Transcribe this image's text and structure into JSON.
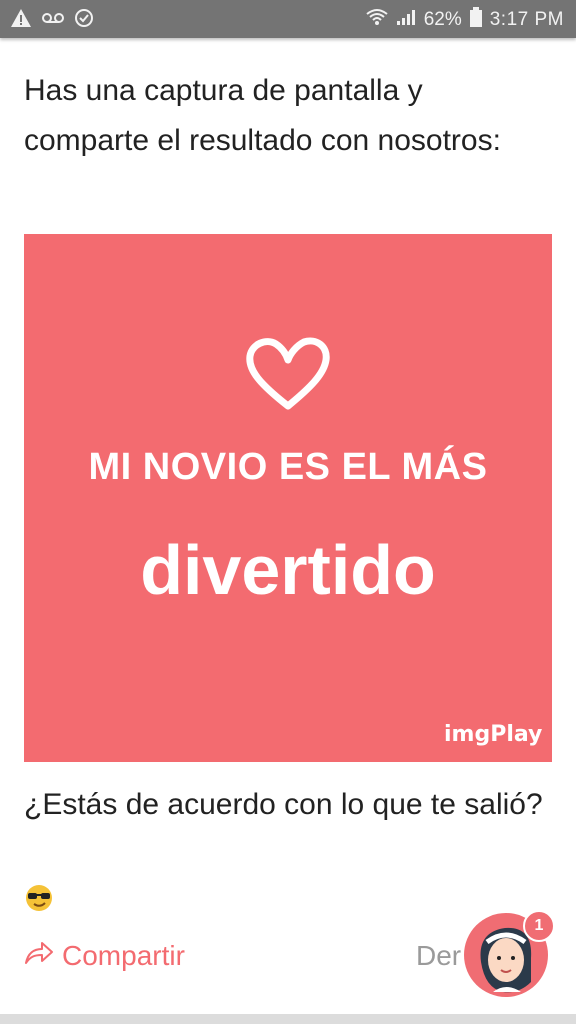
{
  "status_bar": {
    "battery": "62%",
    "time": "3:17 PM",
    "icons": [
      "warning-icon",
      "voicemail-icon",
      "check-circle-icon",
      "wifi-icon",
      "signal-icon",
      "battery-icon"
    ]
  },
  "post": {
    "intro_text": "Has una captura de pantalla y comparte el resultado con nosotros:",
    "image": {
      "line1": "MI NOVIO ES EL MÁS",
      "line2": "divertido",
      "watermark": "imgPlay",
      "background_color": "#f36b70"
    },
    "question": "¿Estás de acuerdo con lo que te salió?",
    "emoji": "😎"
  },
  "actions": {
    "share_label": "Compartir",
    "other_label_partial": "Der"
  },
  "assistant": {
    "badge_count": "1"
  }
}
